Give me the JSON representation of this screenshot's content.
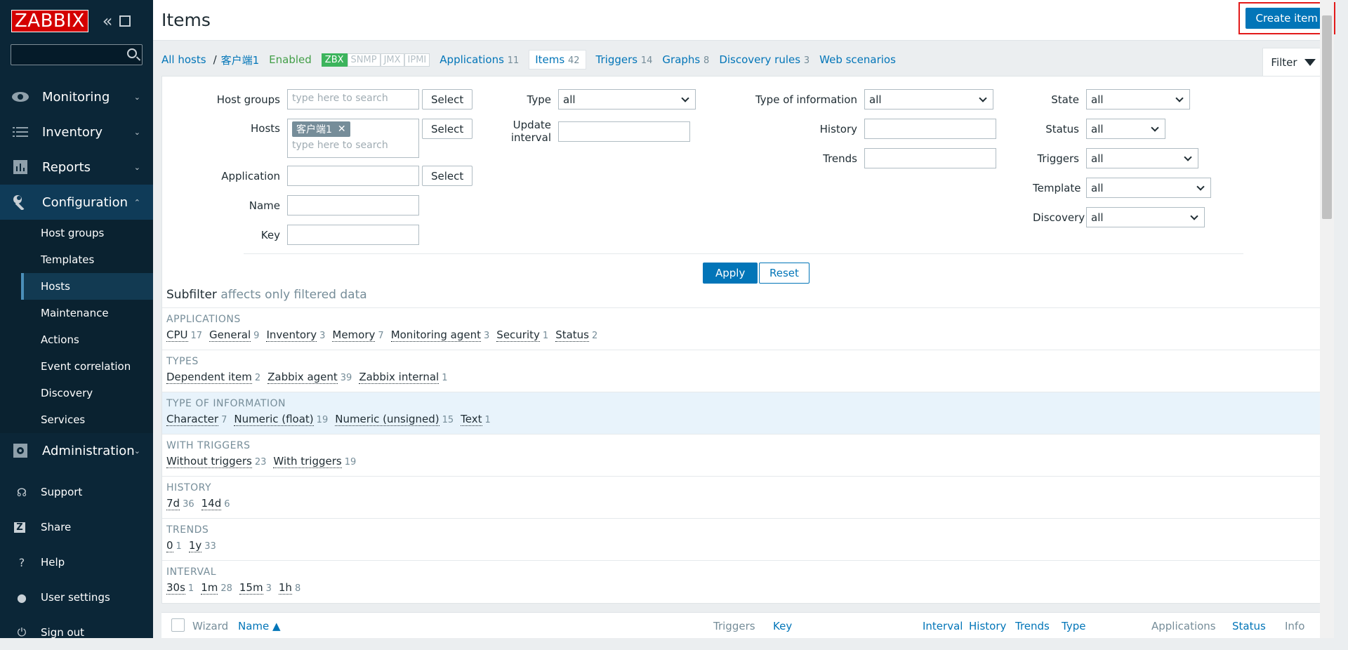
{
  "sidebar": {
    "logo": "ZABBIX",
    "menu": [
      {
        "label": "Monitoring",
        "icon": "eye-icon"
      },
      {
        "label": "Inventory",
        "icon": "list-icon"
      },
      {
        "label": "Reports",
        "icon": "bar-chart-icon"
      },
      {
        "label": "Configuration",
        "icon": "wrench-icon"
      }
    ],
    "config_sub": [
      "Host groups",
      "Templates",
      "Hosts",
      "Maintenance",
      "Actions",
      "Event correlation",
      "Discovery",
      "Services"
    ],
    "administration": "Administration",
    "bottom": [
      "Support",
      "Share",
      "Help",
      "User settings",
      "Sign out"
    ]
  },
  "header": {
    "title": "Items",
    "create_label": "Create item"
  },
  "tabs": {
    "all_hosts": "All hosts",
    "host": "客户端1",
    "enabled": "Enabled",
    "availability": [
      "ZBX",
      "SNMP",
      "JMX",
      "IPMI"
    ],
    "applications": "Applications",
    "applications_count": "11",
    "items": "Items",
    "items_count": "42",
    "triggers": "Triggers",
    "triggers_count": "14",
    "graphs": "Graphs",
    "graphs_count": "8",
    "discovery": "Discovery rules",
    "discovery_count": "3",
    "web": "Web scenarios",
    "filter": "Filter"
  },
  "filter": {
    "host_groups_label": "Host groups",
    "placeholder": "type here to search",
    "select": "Select",
    "hosts_label": "Hosts",
    "host_chip": "客户端1",
    "application_label": "Application",
    "name_label": "Name",
    "key_label": "Key",
    "type_label": "Type",
    "type_value": "all",
    "update_interval_label": "Update interval",
    "type_info_label": "Type of information",
    "type_info_value": "all",
    "history_label": "History",
    "trends_label": "Trends",
    "state_label": "State",
    "state_value": "all",
    "status_label": "Status",
    "status_value": "all",
    "triggers_label": "Triggers",
    "triggers_value": "all",
    "template_label": "Template",
    "template_value": "all",
    "discovery_label": "Discovery",
    "discovery_value": "all",
    "apply": "Apply",
    "reset": "Reset"
  },
  "subfilter": {
    "title": "Subfilter",
    "note": "affects only filtered data",
    "groups": [
      {
        "title": "APPLICATIONS",
        "items": [
          [
            "CPU",
            "17"
          ],
          [
            "General",
            "9"
          ],
          [
            "Inventory",
            "3"
          ],
          [
            "Memory",
            "7"
          ],
          [
            "Monitoring agent",
            "3"
          ],
          [
            "Security",
            "1"
          ],
          [
            "Status",
            "2"
          ]
        ]
      },
      {
        "title": "TYPES",
        "items": [
          [
            "Dependent item",
            "2"
          ],
          [
            "Zabbix agent",
            "39"
          ],
          [
            "Zabbix internal",
            "1"
          ]
        ]
      },
      {
        "title": "TYPE OF INFORMATION",
        "items": [
          [
            "Character",
            "7"
          ],
          [
            "Numeric (float)",
            "19"
          ],
          [
            "Numeric (unsigned)",
            "15"
          ],
          [
            "Text",
            "1"
          ]
        ]
      },
      {
        "title": "WITH TRIGGERS",
        "items": [
          [
            "Without triggers",
            "23"
          ],
          [
            "With triggers",
            "19"
          ]
        ]
      },
      {
        "title": "HISTORY",
        "items": [
          [
            "7d",
            "36"
          ],
          [
            "14d",
            "6"
          ]
        ]
      },
      {
        "title": "TRENDS",
        "items": [
          [
            "0",
            "1"
          ],
          [
            "1y",
            "33"
          ]
        ]
      },
      {
        "title": "INTERVAL",
        "items": [
          [
            "30s",
            "1"
          ],
          [
            "1m",
            "28"
          ],
          [
            "15m",
            "3"
          ],
          [
            "1h",
            "8"
          ]
        ]
      }
    ]
  },
  "table": {
    "wizard": "Wizard",
    "name": "Name ▲",
    "triggers": "Triggers",
    "key": "Key",
    "interval": "Interval",
    "history": "History",
    "trends": "Trends",
    "type": "Type",
    "applications": "Applications",
    "status": "Status",
    "info": "Info"
  }
}
